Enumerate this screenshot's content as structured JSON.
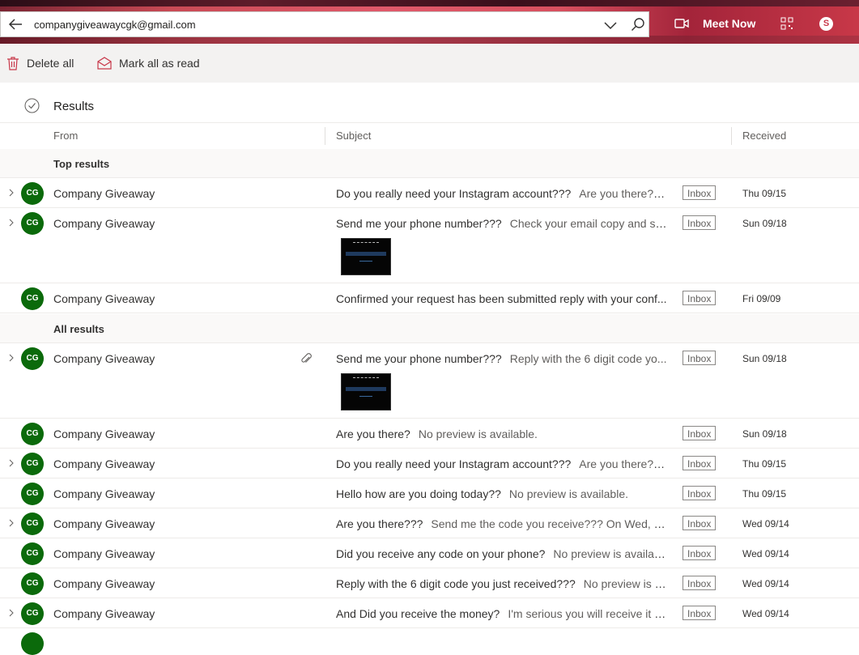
{
  "search": {
    "query": "companygiveawaycgk@gmail.com"
  },
  "header": {
    "meet_now": "Meet Now"
  },
  "toolbar": {
    "delete_all": "Delete all",
    "mark_all_read": "Mark all as read"
  },
  "results": {
    "title": "Results"
  },
  "columns": {
    "from": "From",
    "subject": "Subject",
    "received": "Received"
  },
  "sections": {
    "top": "Top results",
    "all": "All results"
  },
  "rows": [
    {
      "initials": "CG",
      "from": "Company Giveaway",
      "subject": "Do you really need your Instagram account???",
      "preview": "Are you there???...",
      "folder": "Inbox",
      "date": "Thu 09/15"
    },
    {
      "initials": "CG",
      "from": "Company Giveaway",
      "subject": "Send me your phone number???",
      "preview": "Check your email copy and se...",
      "folder": "Inbox",
      "date": "Sun 09/18"
    },
    {
      "initials": "CG",
      "from": "Company Giveaway",
      "subject": "Confirmed your request has been submitted reply with your conf...",
      "preview": "",
      "folder": "Inbox",
      "date": "Fri 09/09"
    },
    {
      "initials": "CG",
      "from": "Company Giveaway",
      "subject": "Send me your phone number???",
      "preview": "Reply with the 6 digit code yo...",
      "folder": "Inbox",
      "date": "Sun 09/18"
    },
    {
      "initials": "CG",
      "from": "Company Giveaway",
      "subject": "Are you there?",
      "preview": "No preview is available.",
      "folder": "Inbox",
      "date": "Sun 09/18"
    },
    {
      "initials": "CG",
      "from": "Company Giveaway",
      "subject": "Do you really need your Instagram account???",
      "preview": "Are you there???...",
      "folder": "Inbox",
      "date": "Thu 09/15"
    },
    {
      "initials": "CG",
      "from": "Company Giveaway",
      "subject": "Hello how are you doing today??",
      "preview": "No preview is available.",
      "folder": "Inbox",
      "date": "Thu 09/15"
    },
    {
      "initials": "CG",
      "from": "Company Giveaway",
      "subject": "Are you there???",
      "preview": "Send me the code you receive??? On Wed, Se...",
      "folder": "Inbox",
      "date": "Wed 09/14"
    },
    {
      "initials": "CG",
      "from": "Company Giveaway",
      "subject": "Did you receive any code on your phone?",
      "preview": "No preview is availab...",
      "folder": "Inbox",
      "date": "Wed 09/14"
    },
    {
      "initials": "CG",
      "from": "Company Giveaway",
      "subject": "Reply with the 6 digit code you just received???",
      "preview": "No preview is a...",
      "folder": "Inbox",
      "date": "Wed 09/14"
    },
    {
      "initials": "CG",
      "from": "Company Giveaway",
      "subject": "And Did you receive the money?",
      "preview": "I'm serious you will receive it a...",
      "folder": "Inbox",
      "date": "Wed 09/14"
    }
  ],
  "colors": {
    "avatar": "#0b6a0b",
    "accent": "#c8384a"
  }
}
